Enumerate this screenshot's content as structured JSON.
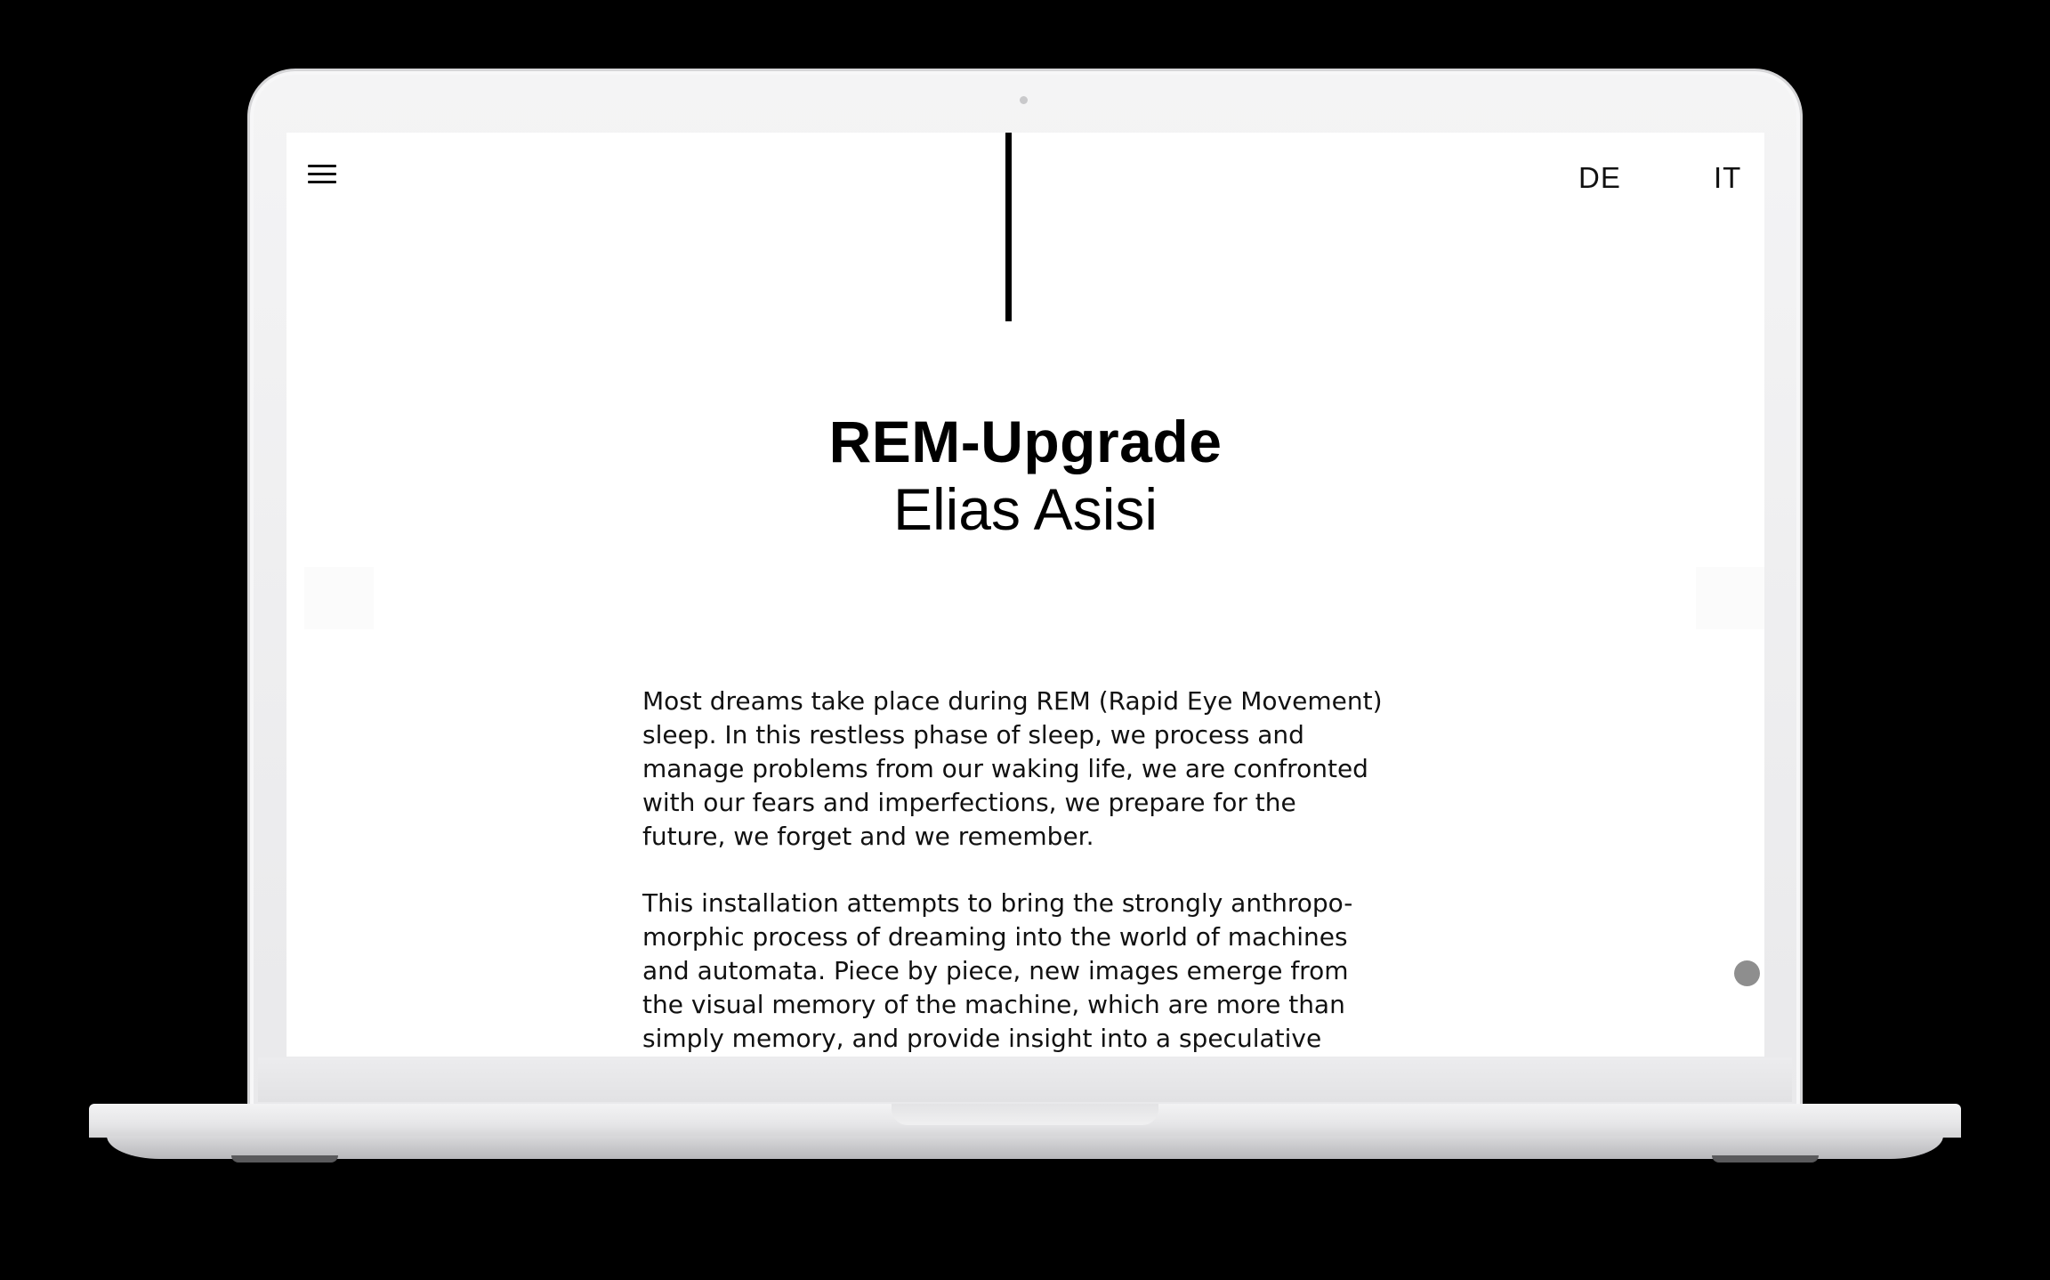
{
  "header": {
    "menu_icon": "hamburger-menu-icon",
    "languages": [
      "DE",
      "IT"
    ]
  },
  "hero": {
    "title": "REM-Upgrade",
    "author": "Elias Asisi"
  },
  "content": {
    "paragraphs": [
      "Most dreams take place during REM (Rapid Eye Movement)\nsleep. In this restless phase of sleep, we process and\nmanage problems from our waking life, we are confronted\nwith our fears and imperfections, we prepare for the\nfuture, we forget and we remember.",
      "This installation attempts to bring the strongly anthropo-\nmorphic process of dreaming into the world of machines\nand automata. Piece by piece, new images emerge from\nthe visual memory of the machine, which are more than\nsimply memory, and provide insight into a speculative"
    ]
  },
  "colors": {
    "background": "#000000",
    "screen": "#ffffff",
    "text": "#000000",
    "scroll_indicator": "#8e8e8e"
  }
}
